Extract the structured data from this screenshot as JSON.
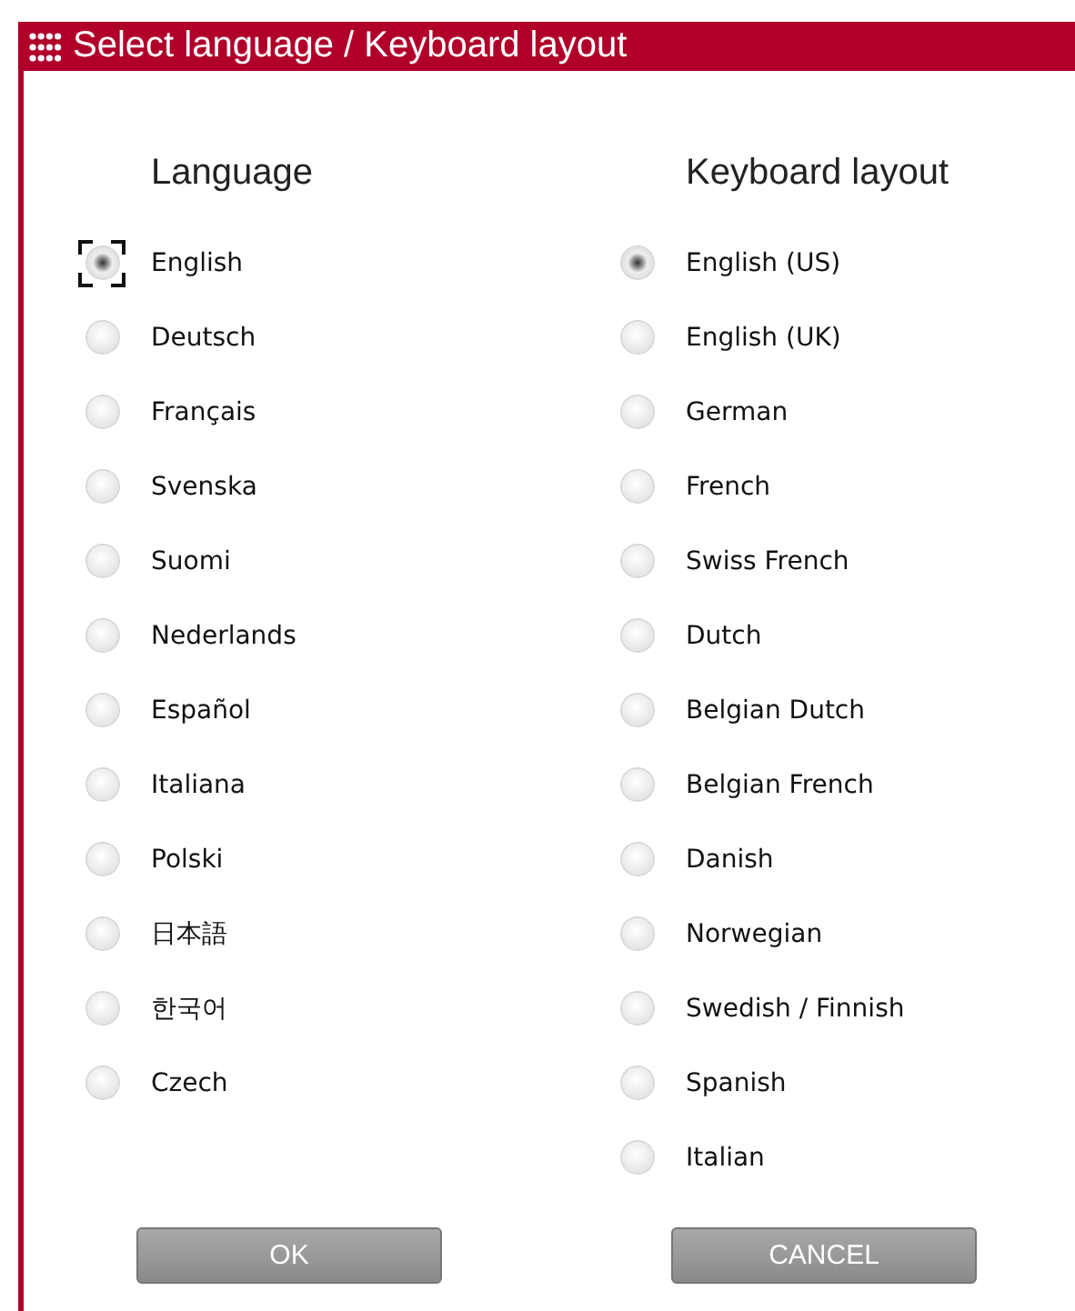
{
  "window": {
    "title": "Select language / Keyboard layout"
  },
  "language": {
    "heading": "Language",
    "options": [
      {
        "label": "English",
        "selected": true,
        "focused": true
      },
      {
        "label": "Deutsch",
        "selected": false,
        "focused": false
      },
      {
        "label": "Français",
        "selected": false,
        "focused": false
      },
      {
        "label": "Svenska",
        "selected": false,
        "focused": false
      },
      {
        "label": "Suomi",
        "selected": false,
        "focused": false
      },
      {
        "label": "Nederlands",
        "selected": false,
        "focused": false
      },
      {
        "label": "Español",
        "selected": false,
        "focused": false
      },
      {
        "label": "Italiana",
        "selected": false,
        "focused": false
      },
      {
        "label": "Polski",
        "selected": false,
        "focused": false
      },
      {
        "label": "日本語",
        "selected": false,
        "focused": false
      },
      {
        "label": "한국어",
        "selected": false,
        "focused": false
      },
      {
        "label": "Czech",
        "selected": false,
        "focused": false
      }
    ]
  },
  "keyboard_layout": {
    "heading": "Keyboard layout",
    "options": [
      {
        "label": "English (US)",
        "selected": true,
        "focused": false
      },
      {
        "label": "English (UK)",
        "selected": false,
        "focused": false
      },
      {
        "label": "German",
        "selected": false,
        "focused": false
      },
      {
        "label": "French",
        "selected": false,
        "focused": false
      },
      {
        "label": "Swiss French",
        "selected": false,
        "focused": false
      },
      {
        "label": "Dutch",
        "selected": false,
        "focused": false
      },
      {
        "label": "Belgian Dutch",
        "selected": false,
        "focused": false
      },
      {
        "label": "Belgian French",
        "selected": false,
        "focused": false
      },
      {
        "label": "Danish",
        "selected": false,
        "focused": false
      },
      {
        "label": "Norwegian",
        "selected": false,
        "focused": false
      },
      {
        "label": "Swedish / Finnish",
        "selected": false,
        "focused": false
      },
      {
        "label": "Spanish",
        "selected": false,
        "focused": false
      },
      {
        "label": "Italian",
        "selected": false,
        "focused": false
      }
    ]
  },
  "buttons": [
    "OK",
    "CANCEL"
  ]
}
